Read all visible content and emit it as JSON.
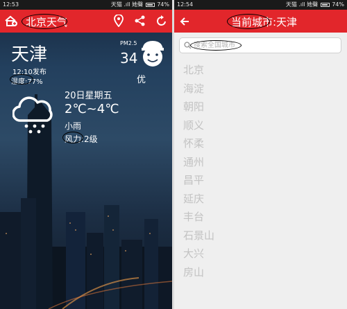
{
  "left_screen": {
    "status_bar": {
      "time": "12:53",
      "carrier_text": "天猫 .ıll 她聲",
      "battery": "74%"
    },
    "app_bar": {
      "title": "北京天气",
      "icons": [
        "add-home-icon",
        "location-pin-icon",
        "share-icon",
        "refresh-icon"
      ]
    },
    "weather": {
      "city": "天津",
      "publish_time": "12:10发布",
      "humidity": "湿度:77%",
      "pm_label": "PM2.5",
      "pm_value": "34",
      "air_quality": "优",
      "date": "20日星期五",
      "temperature": "2℃~4℃",
      "condition": "小雨",
      "wind": "风力:2级",
      "condition_icon": "cloud-snow-icon",
      "air_quality_icon": "smiling-face-icon"
    }
  },
  "right_screen": {
    "status_bar": {
      "time": "12:54",
      "carrier_text": "天猫 .ıll 她聲",
      "battery": "74%"
    },
    "app_bar": {
      "title": "当前城市:天津",
      "icons": [
        "back-arrow-icon"
      ]
    },
    "search": {
      "placeholder": "搜索全国城市",
      "icon": "search-icon"
    },
    "city_list": [
      "北京",
      "海淀",
      "朝阳",
      "顺义",
      "怀柔",
      "通州",
      "昌平",
      "延庆",
      "丰台",
      "石景山",
      "大兴",
      "房山"
    ]
  },
  "colors": {
    "accent": "#e2262b",
    "list_text": "#c2c2c2",
    "panel_bg": "#efefef"
  }
}
